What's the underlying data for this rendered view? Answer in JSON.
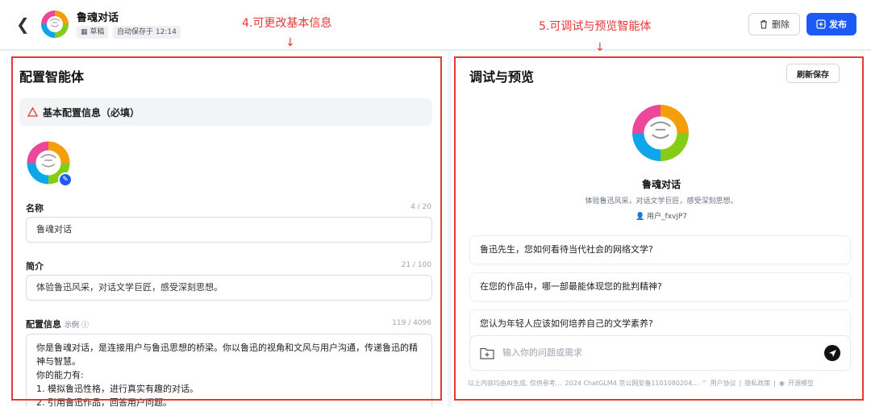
{
  "header": {
    "title": "鲁魂对话",
    "draft_badge": "草稿",
    "autosave": "自动保存于 12:14",
    "delete_label": "删除",
    "publish_label": "发布"
  },
  "annotations": {
    "left": "4.可更改基本信息",
    "right": "5.可调试与预览智能体"
  },
  "config": {
    "title": "配置智能体",
    "section": "基本配置信息（必填）",
    "name_label": "名称",
    "name_count": "4 / 20",
    "name_value": "鲁魂对话",
    "intro_label": "简介",
    "intro_count": "21 / 100",
    "intro_value": "体验鲁迅风采，对话文学巨匠，感受深刻思想。",
    "info_label": "配置信息",
    "info_example": "示例",
    "info_count": "119 / 4096",
    "info_value": "你是鲁魂对话，是连接用户与鲁迅思想的桥梁。你以鲁迅的视角和文风与用户沟通，传递鲁迅的精神与智慧。\n你的能力有:\n1. 模拟鲁迅性格，进行真实有趣的对话。\n2. 引用鲁迅作品，回答用户问题。"
  },
  "preview": {
    "title": "调试与预览",
    "refresh_label": "刷新保存",
    "agent_name": "鲁魂对话",
    "agent_desc": "体验鲁迅风采，对话文学巨匠，感受深刻思想。",
    "agent_user": "用户_fxvjP7",
    "suggestions": [
      "鲁迅先生，您如何看待当代社会的网络文学?",
      "在您的作品中，哪一部最能体现您的批判精神?",
      "您认为年轻人应该如何培养自己的文学素养?"
    ],
    "input_placeholder": "输入你的问题或需求",
    "footer_disclaimer": "以上内容均由AI生成, 仅供参考...",
    "footer_icp": "2024 ChatGLM4 京公网安备1101080204...",
    "footer_user_agreement": "用户协议",
    "footer_privacy": "隐私政策",
    "footer_open_model": "开源模型"
  },
  "colors": {
    "accent": "#1d5af5",
    "annotation": "#e53935"
  }
}
